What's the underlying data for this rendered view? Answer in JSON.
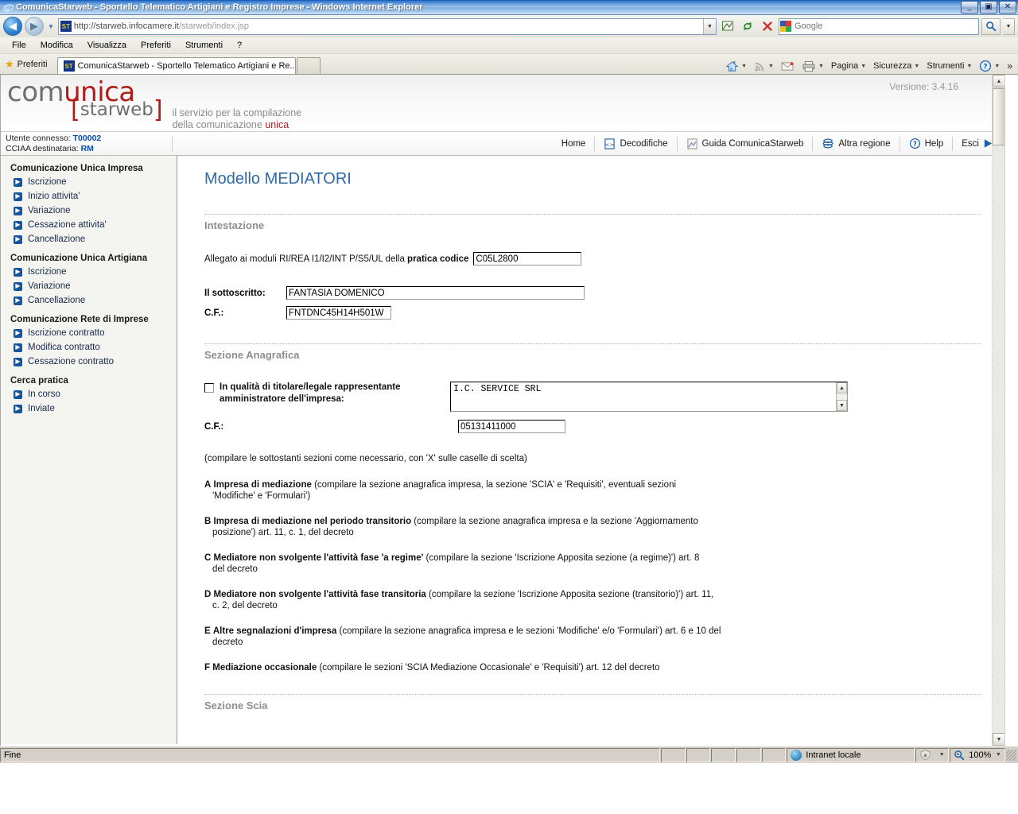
{
  "window": {
    "title": "ComunicaStarweb - Sportello Telematico Artigiani e Registro Imprese - Windows Internet Explorer",
    "minimize": "_",
    "maximize": "▣",
    "close": "✕"
  },
  "browser": {
    "url_protocol": "http://starweb.infocamere.it",
    "url_path": "/starweb/index.jsp",
    "search_placeholder": "Google",
    "menu": [
      "File",
      "Modifica",
      "Visualizza",
      "Preferiti",
      "Strumenti",
      "?"
    ],
    "favorites_label": "Preferiti",
    "tab_label": "ComunicaStarweb - Sportello Telematico Artigiani e Re...",
    "commands": [
      "Pagina",
      "Sicurezza",
      "Strumenti"
    ],
    "overflow": "»"
  },
  "brand": {
    "logo_com": "com",
    "logo_unica": "unica",
    "logo_bracket_open": "[",
    "logo_starweb": "starweb",
    "logo_bracket_close": "]",
    "tagline_line1": "il servizio per la compilazione",
    "tagline_line2_a": "della comunicazione ",
    "tagline_line2_b": "unica",
    "version": "Versione: 3.4.16"
  },
  "user": {
    "connected_label": "Utente connesso:",
    "connected_value": "T00002",
    "ciaa_label": "CCIAA destinataria:",
    "ciaa_value": "RM"
  },
  "topnav": [
    {
      "label": "Home",
      "icon": ""
    },
    {
      "label": "Decodifiche",
      "icon": "decodifiche-icon"
    },
    {
      "label": "Guida ComunicaStarweb",
      "icon": "pdf-guide-icon"
    },
    {
      "label": "Altra regione",
      "icon": "region-icon"
    },
    {
      "label": "Help",
      "icon": "help-icon"
    },
    {
      "label": "Esci",
      "icon": "exit-arrow-icon"
    }
  ],
  "sidebar": {
    "groups": [
      {
        "title": "Comunicazione Unica Impresa",
        "items": [
          "Iscrizione",
          "Inizio attivita'",
          "Variazione",
          "Cessazione attivita'",
          "Cancellazione"
        ]
      },
      {
        "title": "Comunicazione Unica Artigiana",
        "items": [
          "Iscrizione",
          "Variazione",
          "Cancellazione"
        ]
      },
      {
        "title": "Comunicazione Rete di Imprese",
        "items": [
          "Iscrizione contratto",
          "Modifica contratto",
          "Cessazione contratto"
        ]
      },
      {
        "title": "Cerca pratica",
        "items": [
          "In corso",
          "Inviate"
        ]
      }
    ]
  },
  "main": {
    "page_title": "Modello MEDIATORI",
    "section_intestazione": "Intestazione",
    "allegato_text_pre": "Allegato ai moduli RI/REA I1/I2/INT P/S5/UL della ",
    "allegato_text_bold": "pratica codice",
    "pratica_codice_value": "C05L2800",
    "sottoscritto_label": "Il sottoscritto:",
    "sottoscritto_value": "FANTASIA DOMENICO",
    "cf1_label": "C.F.:",
    "cf1_value": "FNTDNC45H14H501W",
    "section_anagrafica": "Sezione Anagrafica",
    "qualita_label_line1": "In qualità di titolare/legale rappresentante",
    "qualita_label_line2": "amministratore dell'impresa:",
    "impresa_value": "I.C. SERVICE SRL",
    "cf2_label": "C.F.:",
    "cf2_value": "05131411000",
    "note": "(compilare le sottostanti sezioni come necessario, con 'X' sulle caselle di scelta)",
    "options": [
      {
        "letter": "A",
        "bold": "Impresa di mediazione",
        "rest": " (compilare la sezione anagrafica impresa, la sezione 'SCIA' e 'Requisiti', eventuali sezioni",
        "cont": "'Modifiche' e 'Formulari')"
      },
      {
        "letter": "B",
        "bold": "Impresa di mediazione nel periodo transitorio",
        "rest": " (compilare la sezione anagrafica impresa e la sezione 'Aggiornamento",
        "cont": "posizione') art. 11, c. 1, del decreto"
      },
      {
        "letter": "C",
        "bold": "Mediatore non svolgente l'attività fase 'a regime'",
        "rest": " (compilare la sezione 'Iscrizione Apposita sezione (a regime)') art. 8",
        "cont": "del decreto"
      },
      {
        "letter": "D",
        "bold": "Mediatore non svolgente l'attività fase transitoria",
        "rest": " (compilare la sezione 'Iscrizione Apposita sezione (transitorio)') art. 11,",
        "cont": "c. 2, del decreto"
      },
      {
        "letter": "E",
        "bold": "Altre segnalazioni d'impresa",
        "rest": " (compilare la sezione anagrafica impresa e le sezioni 'Modifiche' e/o 'Formulari') art. 6 e 10 del",
        "cont": "decreto"
      },
      {
        "letter": "F",
        "bold": "Mediazione occasionale",
        "rest": " (compilare le sezioni 'SCIA Mediazione Occasionale' e 'Requisiti') art. 12 del decreto",
        "cont": ""
      }
    ],
    "section_scia": "Sezione Scia"
  },
  "statusbar": {
    "status": "Fine",
    "zone": "Intranet locale",
    "zoom": "100%"
  }
}
